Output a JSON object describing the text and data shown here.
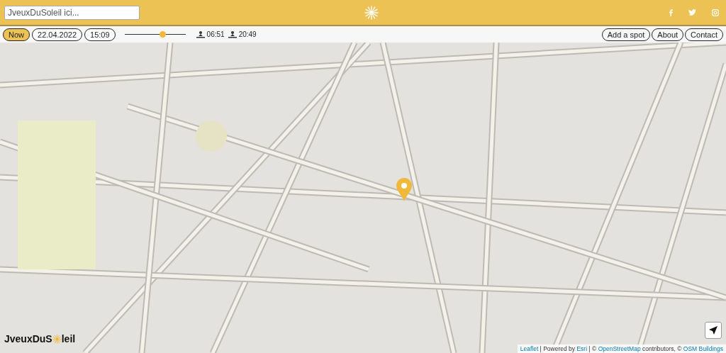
{
  "header": {
    "search": {
      "placeholder": "JveuxDuSoleil ici..."
    }
  },
  "toolbar": {
    "now_button": {
      "label": "Now",
      "selected": true
    },
    "date": "22.04.2022",
    "time": "15:09",
    "time_slider": {
      "level": 0.62
    },
    "sunrise": "06:51",
    "sunset": "20:49",
    "nav": [
      {
        "label": "Add a spot"
      },
      {
        "label": "About"
      },
      {
        "label": "Contact"
      }
    ]
  },
  "map": {
    "logo": {
      "before": "JveuxDuS",
      "after": "leil"
    },
    "attribution": [
      {
        "kind": "link",
        "text": "Leaflet"
      },
      {
        "kind": "text",
        "text": " | Powered by "
      },
      {
        "kind": "link",
        "text": "Esri"
      },
      {
        "kind": "text",
        "text": " | © "
      },
      {
        "kind": "link",
        "text": "OpenStreetMap"
      },
      {
        "kind": "text",
        "text": " contributors, © "
      },
      {
        "kind": "link",
        "text": "OSM Buildings"
      }
    ]
  }
}
